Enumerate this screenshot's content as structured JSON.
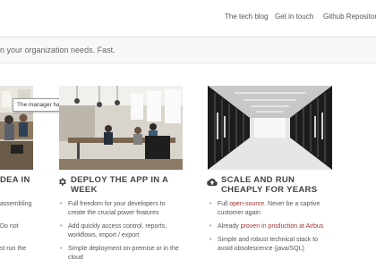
{
  "nav": {
    "links": [
      "The tech blog",
      "Get in touch",
      "Github Repository"
    ]
  },
  "tagline": "n your organization needs. Fast.",
  "tooltip": "The manager has the floor",
  "columns": {
    "left": {
      "heading": "DEA IN",
      "fragments": [
        "assembling",
        "Do not",
        "st run the"
      ]
    },
    "middle": {
      "heading": "DEPLOY THE APP IN A WEEK",
      "icon": "gear-icon",
      "bullets": [
        "Full freedom for your developers to create the crucial power features",
        "Add quickly access control, reports, workflows, import / export",
        "Simple deployment on-premise or in the cloud"
      ]
    },
    "right": {
      "heading": "SCALE AND RUN CHEAPLY FOR YEARS",
      "icon": "cloud-upload-icon",
      "b1": {
        "prefix": "Full ",
        "link": "open-source",
        "suffix": ". Never be a captive customer again"
      },
      "b2": {
        "prefix": "Already ",
        "link": "proven in production at Airbus"
      },
      "b3": "Simple and robust technical stack to avoid obsolescence (java/SQL)"
    }
  },
  "colors": {
    "accent": "#a33434",
    "text": "#555555",
    "heading": "#444444"
  }
}
